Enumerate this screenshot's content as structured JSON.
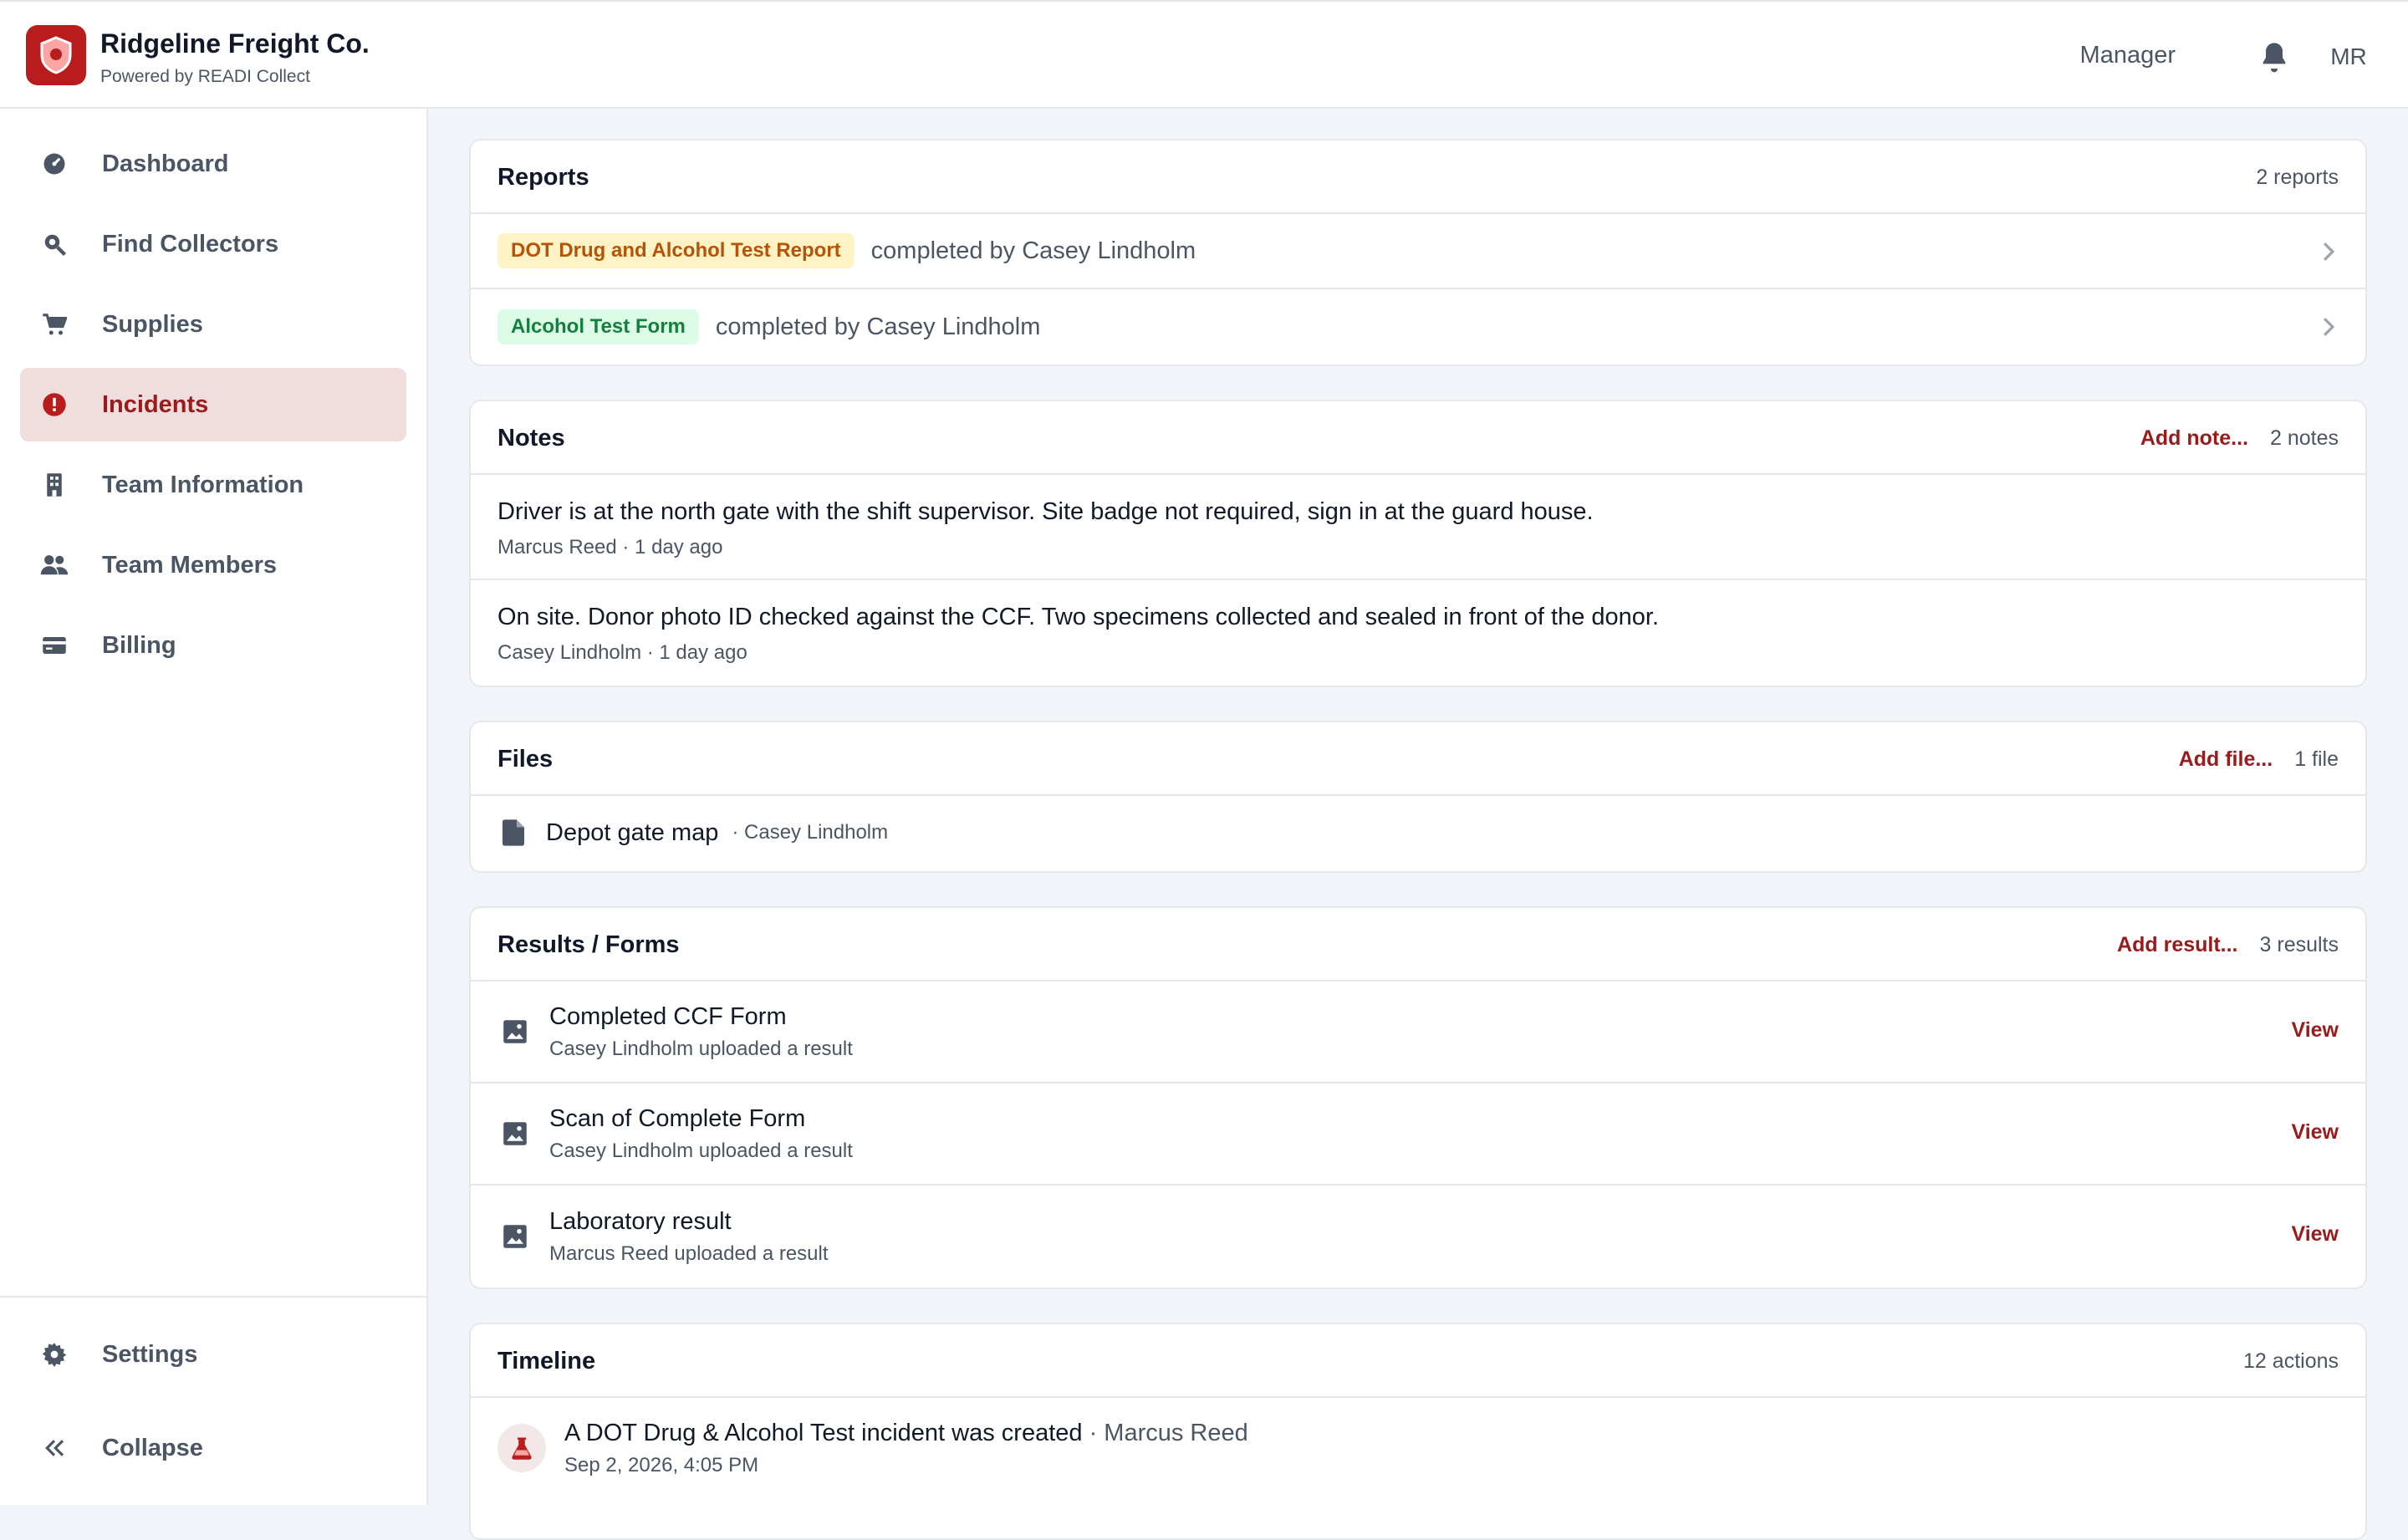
{
  "header": {
    "brand_name": "Ridgeline Freight Co.",
    "brand_sub": "Powered by READI Collect",
    "role": "Manager",
    "avatar_initials": "MR",
    "brand_color": "#b91c1c"
  },
  "sidebar": {
    "items": [
      {
        "label": "Dashboard",
        "icon": "dashboard-icon",
        "active": false
      },
      {
        "label": "Find Collectors",
        "icon": "search-icon",
        "active": false
      },
      {
        "label": "Supplies",
        "icon": "cart-icon",
        "active": false
      },
      {
        "label": "Incidents",
        "icon": "alert-icon",
        "active": true
      },
      {
        "label": "Team Information",
        "icon": "building-icon",
        "active": false
      },
      {
        "label": "Team Members",
        "icon": "people-icon",
        "active": false
      },
      {
        "label": "Billing",
        "icon": "card-icon",
        "active": false
      }
    ],
    "settings_label": "Settings",
    "collapse_label": "Collapse"
  },
  "reports": {
    "title": "Reports",
    "count": "2 reports",
    "items": [
      {
        "tag": "DOT Drug and Alcohol Test Report",
        "text": "completed by Casey Lindholm"
      },
      {
        "tag": "Alcohol Test Form",
        "text": "completed by Casey Lindholm"
      }
    ]
  },
  "notes": {
    "title": "Notes",
    "action": "Add note...",
    "count": "2 notes",
    "items": [
      {
        "text": "Driver is at the north gate with the shift supervisor. Site badge not required, sign in at the guard house.",
        "meta": "Marcus Reed · 1 day ago"
      },
      {
        "text": "On site. Donor photo ID checked against the CCF. Two specimens collected and sealed in front of the donor.",
        "meta": "Casey Lindholm · 1 day ago"
      }
    ]
  },
  "files": {
    "title": "Files",
    "action": "Add file...",
    "count": "1 file",
    "items": [
      {
        "name": "Depot gate map",
        "by": "· Casey Lindholm"
      }
    ]
  },
  "results": {
    "title": "Results / Forms",
    "action": "Add result...",
    "count": "3 results",
    "view_label": "View",
    "items": [
      {
        "title": "Completed CCF Form",
        "sub": "Casey Lindholm uploaded a result"
      },
      {
        "title": "Scan of Complete Form",
        "sub": "Casey Lindholm uploaded a result"
      },
      {
        "title": "Laboratory result",
        "sub": "Marcus Reed uploaded a result"
      }
    ]
  },
  "timeline": {
    "title": "Timeline",
    "count": "12 actions",
    "items": [
      {
        "text": "A DOT Drug & Alcohol Test incident was created",
        "actor": "· Marcus Reed",
        "date": "Sep 2, 2026, 4:05 PM"
      }
    ]
  }
}
